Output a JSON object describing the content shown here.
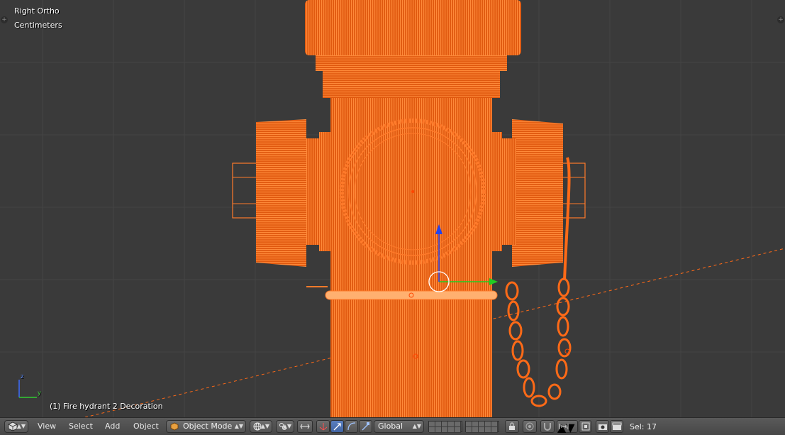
{
  "viewport": {
    "view_name": "Right Ortho",
    "units": "Centimeters",
    "object_label": "(1) Fire hydrant 2 Decoration",
    "axis_labels": {
      "z": "z",
      "y": "y"
    },
    "colors": {
      "background": "#3a3a3a",
      "wire": "#ff6a17",
      "grid": "#444444",
      "gizmo_y": "#22cc22",
      "gizmo_z": "#2244ee"
    }
  },
  "header": {
    "editor_icon": "3d-view-cube-icon",
    "menus": {
      "view": "View",
      "select": "Select",
      "add": "Add",
      "object": "Object"
    },
    "mode": "Object Mode",
    "orientation": "Global",
    "selection": "Sel: 17"
  }
}
